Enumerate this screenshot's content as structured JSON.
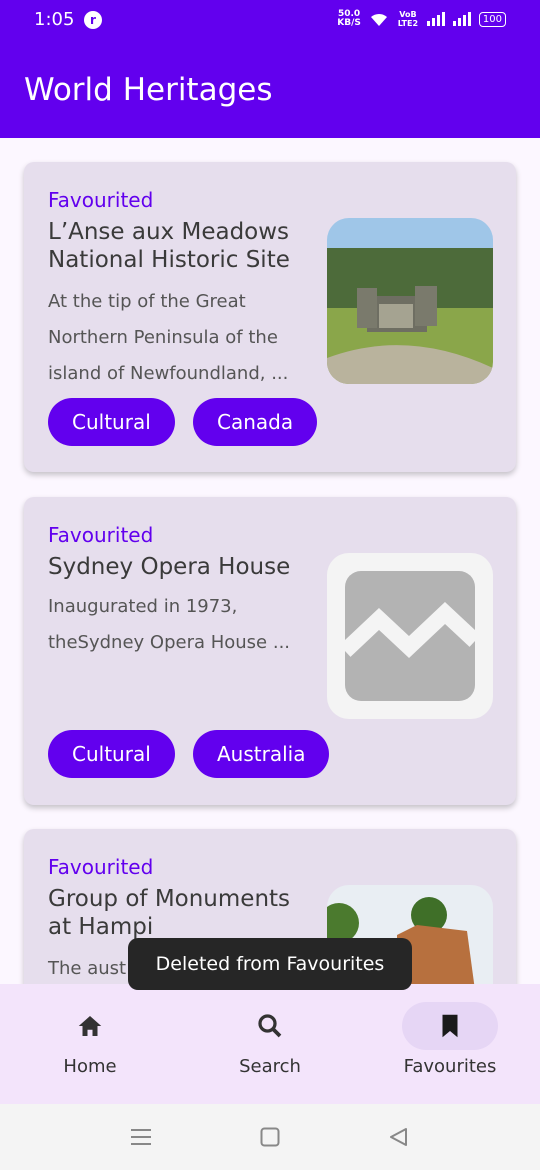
{
  "status_bar": {
    "time": "1:05",
    "app_icon": "r-app-icon",
    "net_speed": "50.0",
    "net_unit": "KB/S",
    "volte": "VoB LTE2",
    "battery": "100"
  },
  "app_bar": {
    "title": "World Heritages"
  },
  "cards": [
    {
      "status": "Favourited",
      "name": "L’Anse aux Meadows National Historic Site",
      "description": "At the tip of the Great Northern Peninsula of the island of Newfoundland, ...",
      "image": "photo of turf house ruins",
      "chips": [
        "Cultural",
        "Canada"
      ]
    },
    {
      "status": "Favourited",
      "name": "Sydney Opera House",
      "description": "Inaugurated in 1973, theSydney Opera House ...",
      "image": "image-placeholder-icon",
      "chips": [
        "Cultural",
        "Australia"
      ]
    },
    {
      "status": "Favourited",
      "name": "Group of Monuments at Hampi",
      "description": "The aust",
      "image": "photo of temple with palm trees",
      "chips": []
    }
  ],
  "toast": {
    "message": "Deleted from Favourites"
  },
  "bottom_nav": {
    "items": [
      {
        "label": "Home",
        "icon": "home-icon",
        "active": false
      },
      {
        "label": "Search",
        "icon": "search-icon",
        "active": false
      },
      {
        "label": "Favourites",
        "icon": "bookmark-icon",
        "active": true
      }
    ]
  },
  "system_nav": [
    "menu-icon",
    "home-square-icon",
    "back-triangle-icon"
  ]
}
